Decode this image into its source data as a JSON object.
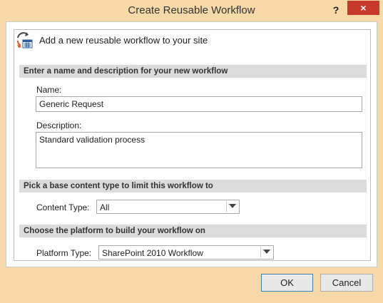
{
  "window": {
    "title": "Create Reusable Workflow",
    "help_label": "?",
    "close_label": "×"
  },
  "header": {
    "text": "Add a new reusable workflow to your site",
    "icon": "workflow-icon"
  },
  "sections": {
    "name_desc": "Enter a name and description for your new workflow",
    "content_type": "Pick a base content type to limit this workflow to",
    "platform": "Choose the platform to build your workflow on"
  },
  "fields": {
    "name_label": "Name:",
    "name_value": "Generic Request",
    "description_label": "Description:",
    "description_value": "Standard validation process",
    "content_type_label": "Content Type:",
    "content_type_value": "All",
    "platform_label": "Platform Type:",
    "platform_value": "SharePoint 2010 Workflow"
  },
  "buttons": {
    "ok": "OK",
    "cancel": "Cancel"
  },
  "colors": {
    "frame": "#f7d9a9",
    "close": "#c7392c",
    "section_bar": "#dcdcdc"
  }
}
